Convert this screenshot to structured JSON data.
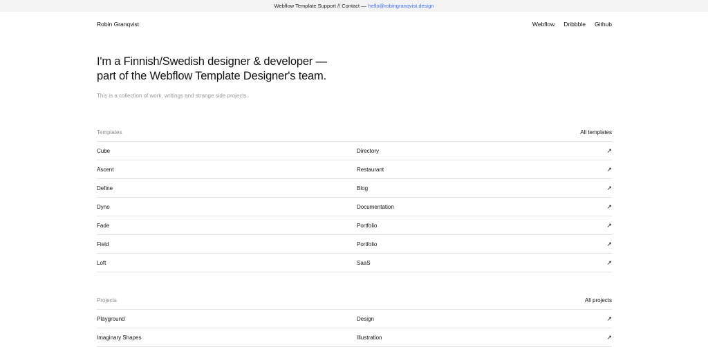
{
  "topbar": {
    "text": "Webflow Template Support // Contact —",
    "email": "hello@robingranqvist.design"
  },
  "nav": {
    "brand": "Robin Granqvist",
    "links": [
      "Webflow",
      "Dribbble",
      "Github"
    ]
  },
  "hero": {
    "headline": "I'm a Finnish/Swedish designer & developer — part of the Webflow Template Designer's team.",
    "subtitle": "This is a collection of work, writings and strange side projects."
  },
  "templates": {
    "label": "Templates",
    "all_link": "All templates",
    "rows": [
      {
        "name": "Cube",
        "category": "Directory"
      },
      {
        "name": "Ascent",
        "category": "Restaurant"
      },
      {
        "name": "Define",
        "category": "Blog"
      },
      {
        "name": "Dyno",
        "category": "Documentation"
      },
      {
        "name": "Fade",
        "category": "Portfolio"
      },
      {
        "name": "Field",
        "category": "Portfolio"
      },
      {
        "name": "Loft",
        "category": "SaaS"
      }
    ]
  },
  "projects": {
    "label": "Projects",
    "all_link": "All projects",
    "rows": [
      {
        "name": "Playground",
        "category": "Design"
      },
      {
        "name": "Imaginary Shapes",
        "category": "Illustration"
      }
    ]
  },
  "icons": {
    "row_arrow": "arrow-up-right-icon"
  },
  "colors": {
    "link": "#3a6df0",
    "muted": "#9a9a9a",
    "divider": "#e2e2e2"
  }
}
